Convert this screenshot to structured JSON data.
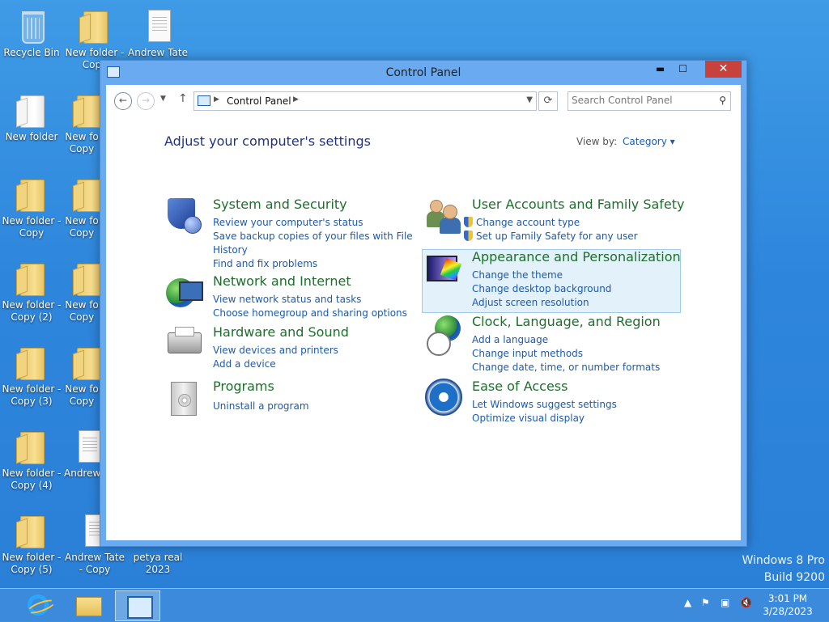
{
  "desktop": {
    "icons": [
      {
        "label": "Recycle Bin"
      },
      {
        "label": "New folder - Copy"
      },
      {
        "label": "Andrew Tate"
      },
      {
        "label": "New folder"
      },
      {
        "label": "New fo Copy"
      },
      {
        "label": "New folder - Copy"
      },
      {
        "label": "New fo Copy"
      },
      {
        "label": "New folder - Copy (2)"
      },
      {
        "label": "New fo Copy"
      },
      {
        "label": "New folder - Copy (3)"
      },
      {
        "label": "New fo Copy"
      },
      {
        "label": "New folder - Copy (4)"
      },
      {
        "label": "Andrew"
      },
      {
        "label": "New folder - Copy (5)"
      },
      {
        "label": "Andrew Tate - Copy"
      },
      {
        "label": "petya real 2023"
      }
    ]
  },
  "window": {
    "title": "Control Panel",
    "minimize": "▬",
    "maximize": "☐",
    "close": "✕"
  },
  "address_bar": {
    "path": "Control Panel",
    "search_placeholder": "Search Control Panel"
  },
  "content": {
    "heading": "Adjust your computer's settings",
    "view_by_label": "View by:",
    "view_by_value": "Category ▾",
    "categories": [
      {
        "title": "System and Security",
        "icon": "shield-icon",
        "links": [
          "Review your computer's status",
          "Save backup copies of your files with File",
          "History",
          "Find and fix problems"
        ]
      },
      {
        "title": "Network and Internet",
        "icon": "network-icon",
        "links": [
          "View network status and tasks",
          "Choose homegroup and sharing options"
        ]
      },
      {
        "title": "Hardware and Sound",
        "icon": "printer-icon",
        "links": [
          "View devices and printers",
          "Add a device"
        ]
      },
      {
        "title": "Programs",
        "icon": "programs-icon",
        "links": [
          "Uninstall a program"
        ]
      },
      {
        "title": "User Accounts and Family Safety",
        "icon": "users-icon",
        "links": [
          "Change account type",
          "Set up Family Safety for any user"
        ]
      },
      {
        "title": "Appearance and Personalization",
        "icon": "appearance-icon",
        "links": [
          "Change the theme",
          "Change desktop background",
          "Adjust screen resolution"
        ]
      },
      {
        "title": "Clock, Language, and Region",
        "icon": "clock-globe-icon",
        "links": [
          "Add a language",
          "Change input methods",
          "Change date, time, or number formats"
        ]
      },
      {
        "title": "Ease of Access",
        "icon": "ease-of-access-icon",
        "links": [
          "Let Windows suggest settings",
          "Optimize visual display"
        ]
      }
    ]
  },
  "watermark": {
    "line1": "Windows 8 Pro",
    "line2": "Build 9200"
  },
  "taskbar": {
    "time": "3:01 PM",
    "date": "3/28/2023"
  }
}
